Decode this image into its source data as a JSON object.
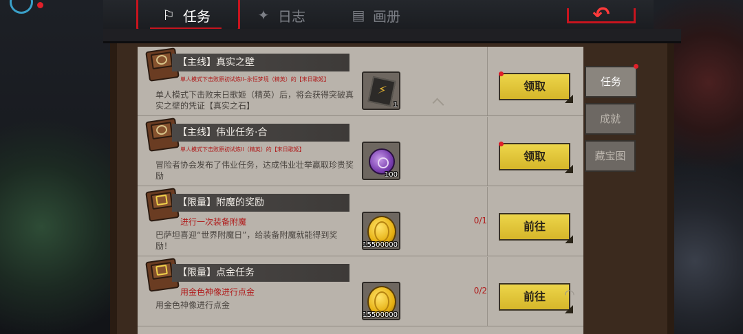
{
  "top_tabs": [
    {
      "label": "任务",
      "icon": "quest-icon",
      "active": true
    },
    {
      "label": "日志",
      "icon": "log-icon",
      "active": false
    },
    {
      "label": "画册",
      "icon": "album-icon",
      "active": false
    }
  ],
  "back_button": {
    "icon": "back-arrow-icon"
  },
  "side_tabs": [
    {
      "label": "任务",
      "active": true
    },
    {
      "label": "成就",
      "active": false
    },
    {
      "label": "藏宝图",
      "active": false
    }
  ],
  "quests": [
    {
      "title": "【主线】真实之壁",
      "requirement": "单人模式下击败原初试炼II–永恒梦境（精英）的【末日歌姬】",
      "progress": "",
      "description": "单人模式下击败末日歌姬（精英）后，将会获得突破真实之壁的凭证【真实之石】",
      "reward_icon": "rune-stone-icon",
      "reward_count": "1",
      "action": "领取",
      "has_badge": true
    },
    {
      "title": "【主线】伟业任务·合",
      "requirement": "单人模式下击败原初试炼II（精英）的【末日歌姬】",
      "progress": "",
      "description": "冒险者协会发布了伟业任务，达成伟业壮举赢取珍贵奖励",
      "reward_icon": "purple-gem-icon",
      "reward_count": "100",
      "action": "领取",
      "has_badge": true
    },
    {
      "title": "【限量】附魔的奖励",
      "requirement": "进行一次装备附魔",
      "progress": "0/1",
      "description": "巴萨坦喜迎“世界附魔日”，给装备附魔就能得到奖励！",
      "reward_icon": "gold-coin-icon",
      "reward_count": "15500000",
      "action": "前往",
      "has_badge": false
    },
    {
      "title": "【限量】点金任务",
      "requirement": "用金色神像进行点金",
      "progress": "0/2",
      "description": "用金色神像进行点金",
      "reward_icon": "gold-coin-icon",
      "reward_count": "15500000",
      "action": "前往",
      "has_badge": false
    }
  ]
}
